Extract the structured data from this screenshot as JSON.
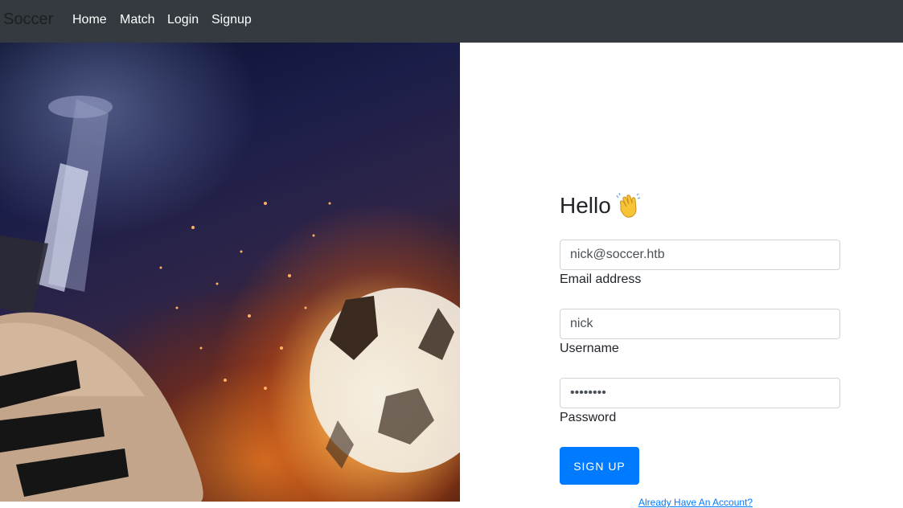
{
  "navbar": {
    "brand": "Soccer",
    "links": [
      {
        "label": "Home"
      },
      {
        "label": "Match"
      },
      {
        "label": "Login"
      },
      {
        "label": "Signup"
      }
    ],
    "background": "#343a40"
  },
  "hero": {
    "alt": "soccer cleat and ball in flames"
  },
  "form": {
    "greeting": "Hello",
    "greeting_icon": "waving-hand-emoji",
    "email": {
      "value": "nick@soccer.htb",
      "label": "Email address"
    },
    "username": {
      "value": "nick",
      "label": "Username"
    },
    "password": {
      "value": "••••••••",
      "label": "Password"
    },
    "submit_label": "SIGN UP",
    "login_link": "Already Have An Account?"
  },
  "colors": {
    "accent": "#007bff",
    "text": "#212529"
  }
}
